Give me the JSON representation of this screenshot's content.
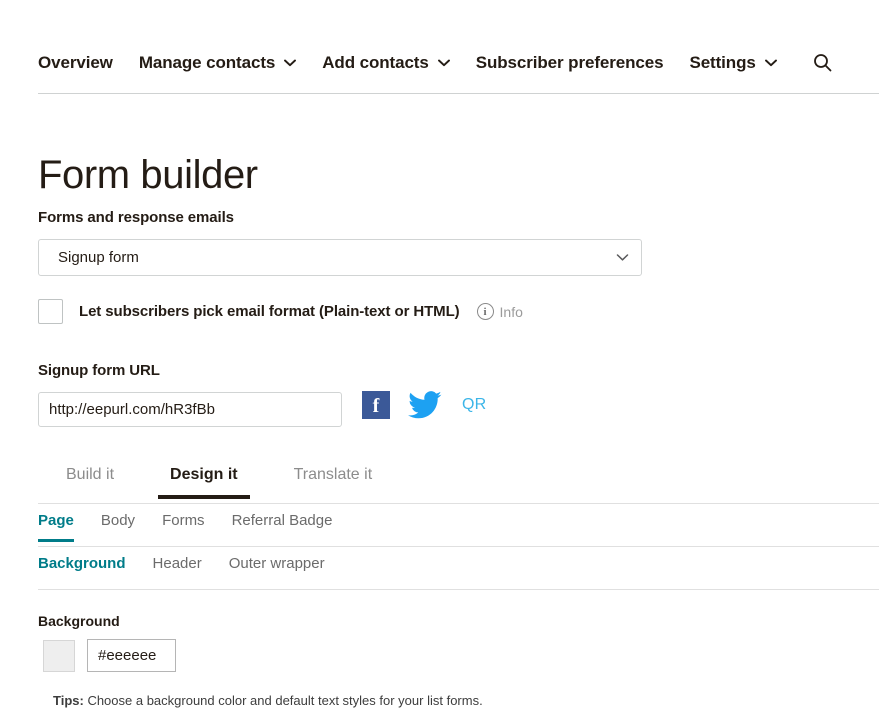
{
  "nav": {
    "items": [
      {
        "label": "Overview",
        "has_caret": false
      },
      {
        "label": "Manage contacts",
        "has_caret": true
      },
      {
        "label": "Add contacts",
        "has_caret": true
      },
      {
        "label": "Subscriber preferences",
        "has_caret": false
      },
      {
        "label": "Settings",
        "has_caret": true
      }
    ],
    "search_icon": "search-icon"
  },
  "page": {
    "title": "Form builder"
  },
  "forms_section": {
    "label": "Forms and response emails",
    "select_value": "Signup form",
    "select_caret_icon": "chevron-down-icon"
  },
  "email_format": {
    "checkbox_checked": false,
    "label_main": "Let subscribers pick email format ",
    "label_sub": "(Plain-text or HTML)",
    "info_icon": "info-circle-icon",
    "info_label": "Info"
  },
  "signup_url": {
    "label": "Signup form URL",
    "value": "http://eepurl.com/hR3fBb",
    "placeholder": "http://eepurl.com/hR3fBb",
    "facebook_icon": "facebook-icon",
    "facebook_glyph": "f",
    "twitter_icon": "twitter-icon",
    "qr_label": "QR"
  },
  "tabs_primary": [
    {
      "label": "Build it",
      "active": false
    },
    {
      "label": "Design it",
      "active": true
    },
    {
      "label": "Translate it",
      "active": false
    }
  ],
  "tabs_secondary": [
    {
      "label": "Page",
      "active": true
    },
    {
      "label": "Body",
      "active": false
    },
    {
      "label": "Forms",
      "active": false
    },
    {
      "label": "Referral Badge",
      "active": false
    }
  ],
  "tabs_tertiary": [
    {
      "label": "Background",
      "active": true
    },
    {
      "label": "Header",
      "active": false
    },
    {
      "label": "Outer wrapper",
      "active": false
    }
  ],
  "background_control": {
    "label": "Background",
    "swatch_color": "#eeeeee",
    "hex_value": "#eeeeee",
    "tips_prefix": "Tips:",
    "tips_text": " Choose a background color and default text styles for your list forms."
  },
  "colors": {
    "accent_teal": "#007c89",
    "text_dark": "#241c15",
    "facebook_blue": "#3b5998",
    "twitter_blue": "#1da1f2",
    "qr_blue": "#3bb5e8",
    "border_gray": "#d1d4d4"
  }
}
